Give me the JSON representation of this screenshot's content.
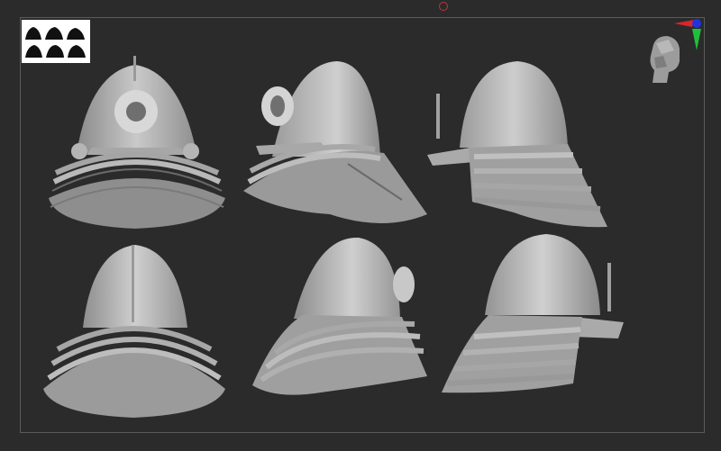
{
  "viewport": {
    "background": "#2b2b2b",
    "frame_color": "#5b5b5b",
    "model_color": "#bdbdbd"
  },
  "thumbnail": {
    "icon": "helmet-silhouettes-thumbnail"
  },
  "gizmo": {
    "icon": "axis-gizmo-icon",
    "colors": {
      "x": "#d8262a",
      "y": "#1fbf3a",
      "z": "#2233dd"
    }
  },
  "navigation": {
    "icon": "navigation-head-icon"
  },
  "views": [
    "helmet-front-view",
    "helmet-three-quarter-view",
    "helmet-side-view",
    "helmet-back-view",
    "helmet-back-three-quarter-view",
    "helmet-other-side-view"
  ]
}
